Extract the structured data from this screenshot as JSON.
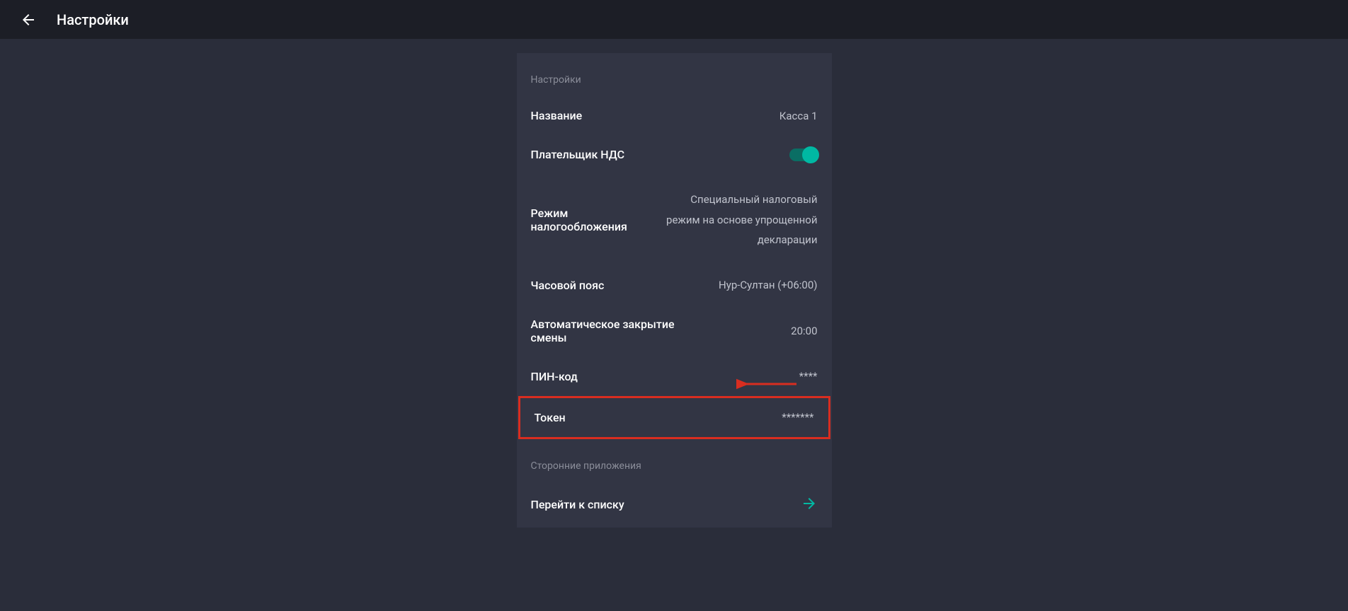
{
  "header": {
    "title": "Настройки"
  },
  "settings": {
    "section_label": "Настройки",
    "rows": {
      "name": {
        "label": "Название",
        "value": "Касса 1"
      },
      "vat_payer": {
        "label": "Плательщик НДС",
        "enabled": true
      },
      "tax_mode": {
        "label": "Режим налогообложения",
        "value": "Специальный налоговый режим на основе упрощенной декларации"
      },
      "timezone": {
        "label": "Часовой пояс",
        "value": "Нур-Султан (+06:00)"
      },
      "auto_close": {
        "label": "Автоматическое закрытие смены",
        "value": "20:00"
      },
      "pin_code": {
        "label": "ПИН-код",
        "value": "****"
      },
      "token": {
        "label": "Токен",
        "value": "*******"
      }
    }
  },
  "external_apps": {
    "section_label": "Сторонние приложения",
    "go_to_list": "Перейти к списку"
  }
}
